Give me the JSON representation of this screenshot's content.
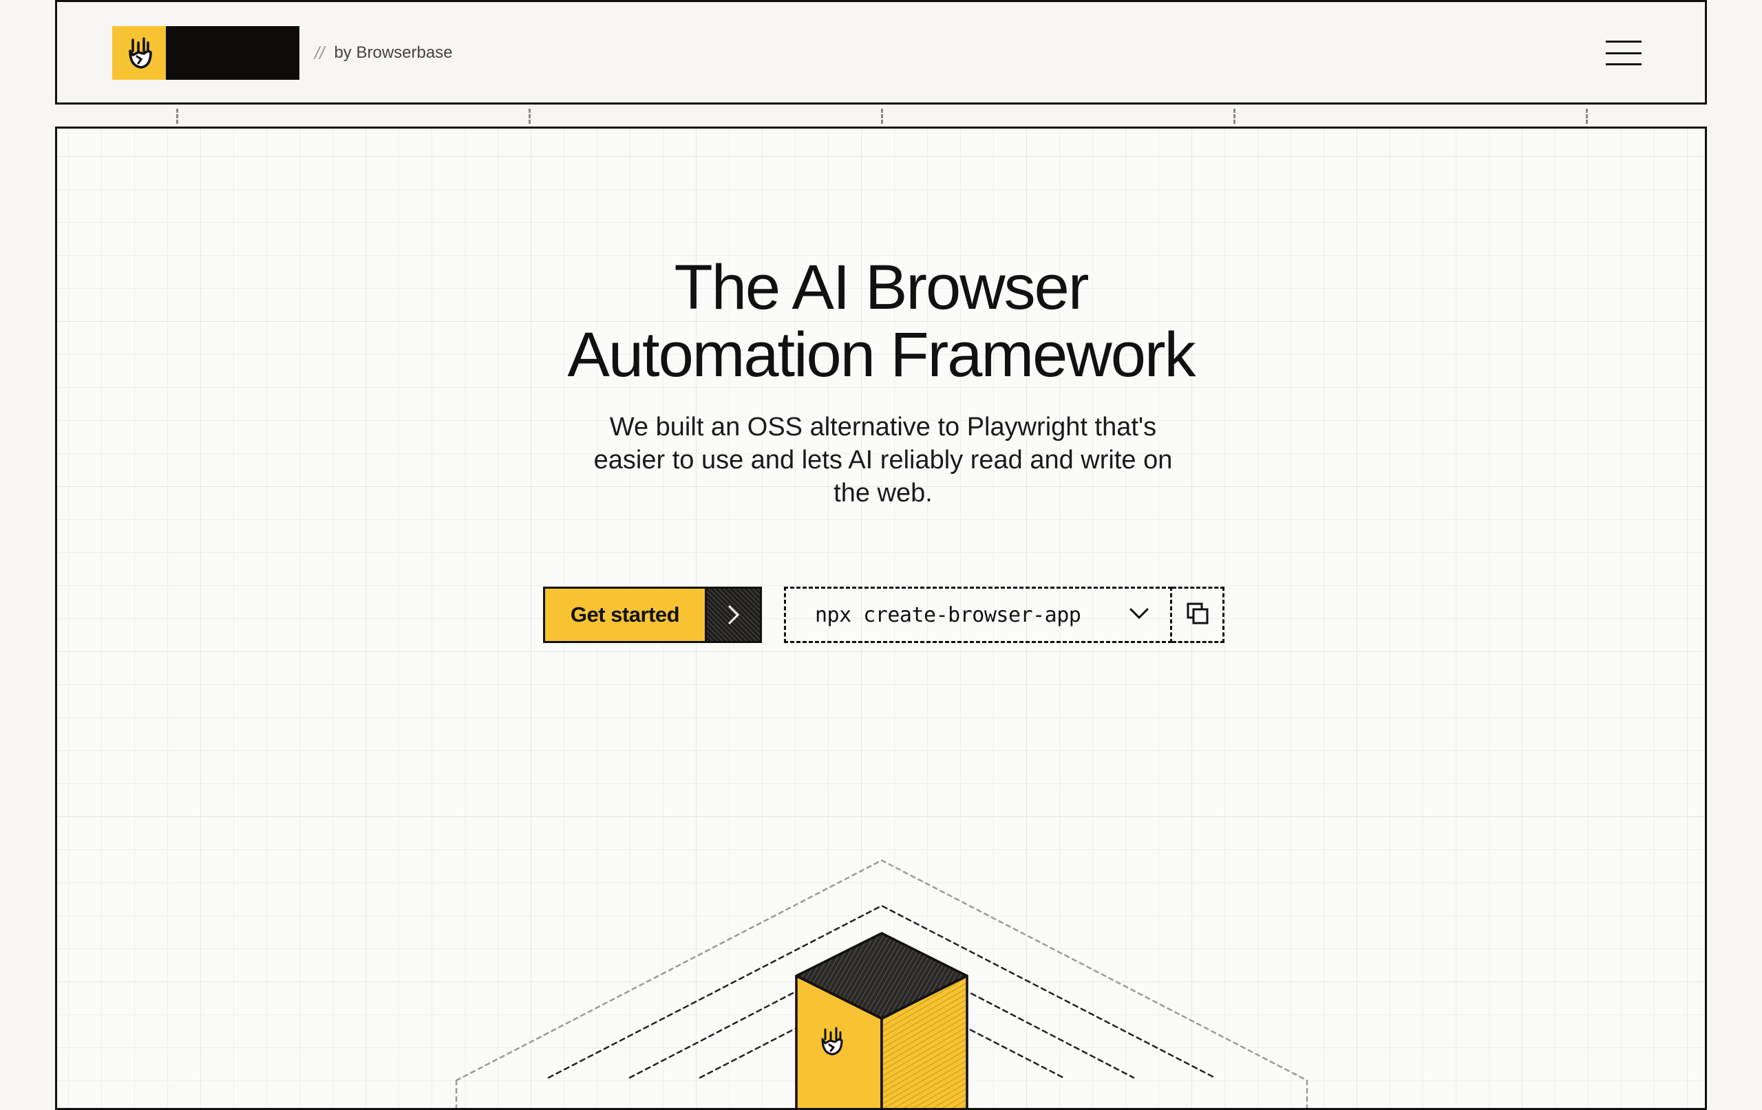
{
  "header": {
    "by_slash": "//",
    "by_label": "by Browserbase",
    "menu_icon": "hamburger-menu-icon",
    "logo_icon": "rock-hand-icon",
    "brand_yellow": "#f7c332",
    "brand_black": "#0e0c0a"
  },
  "hero": {
    "title_line1": "The AI Browser",
    "title_line2": "Automation Framework",
    "subtitle": "We built an OSS alternative to Playwright that's easier to use and lets AI reliably read and write on the web."
  },
  "cta": {
    "label": "Get started",
    "arrow_icon": "chevron-right-icon"
  },
  "command": {
    "text": "npx create-browser-app",
    "dropdown_icon": "chevron-down-icon",
    "copy_icon": "copy-icon"
  },
  "illustration": {
    "icon": "isometric-cube-icon"
  }
}
